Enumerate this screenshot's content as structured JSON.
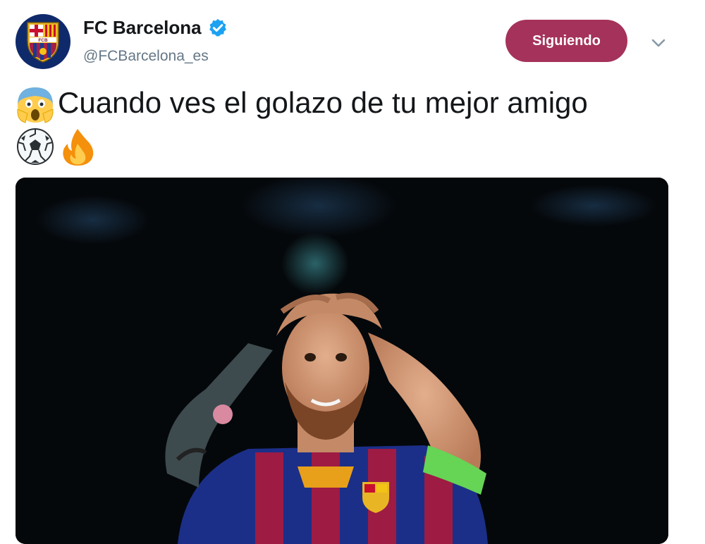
{
  "account": {
    "display_name": "FC Barcelona",
    "handle": "@FCBarcelona_es",
    "verified_icon": "verified-badge-icon",
    "avatar_icon": "fcb-crest-icon",
    "avatar_crest_text": "FCB"
  },
  "actions": {
    "follow_label": "Siguiendo",
    "follow_color": "#a5325a",
    "more_icon": "chevron-down-icon"
  },
  "tweet": {
    "text": "Cuando ves el golazo de tu mejor amigo",
    "emojis": [
      "screaming-face-emoji",
      "soccer-ball-emoji",
      "fire-emoji"
    ]
  },
  "media": {
    "type": "photo",
    "subject": "player-with-hands-on-head-photo"
  }
}
